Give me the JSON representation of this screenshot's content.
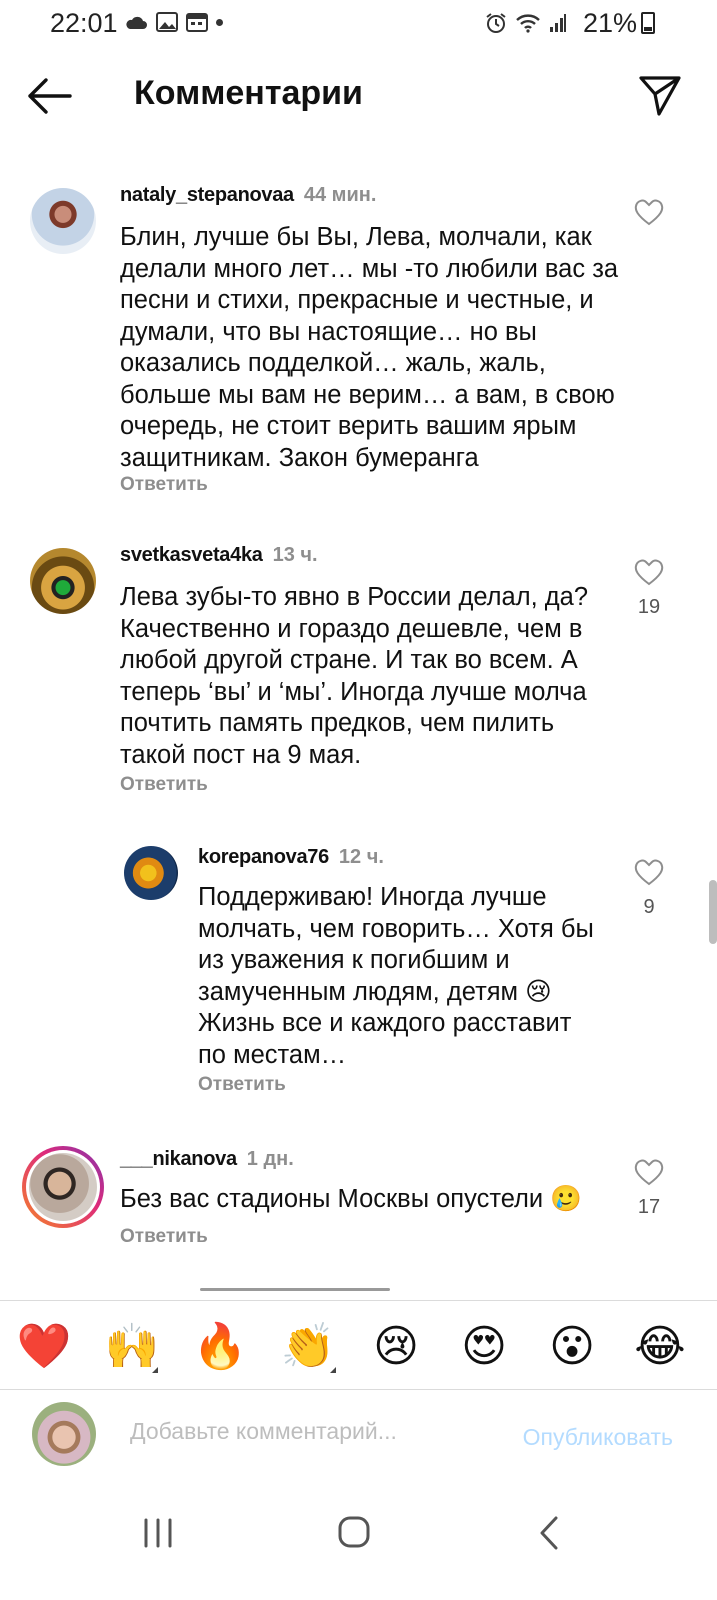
{
  "status_bar": {
    "time": "22:01",
    "battery_text": "21%",
    "left_icons": [
      "cloud-icon",
      "image-icon",
      "calendar-icon",
      "dot-icon"
    ],
    "right_icons": [
      "alarm-icon",
      "wifi-icon",
      "signal-icon",
      "battery-icon"
    ]
  },
  "header": {
    "title": "Комментарии",
    "back_icon": "arrow-left-icon",
    "send_icon": "paper-plane-icon"
  },
  "comments": [
    {
      "username": "nataly_stepanovaa",
      "time": "44 мин.",
      "text": "Блин, лучше бы Вы, Лева, молчали, как делали много лет… мы -то любили вас за песни и стихи, прекрасные и честные, и думали, что вы настоящие… но вы оказались подделкой… жаль, жаль, больше мы вам не верим… а вам, в свою очередь, не стоит верить вашим ярым защитникам. Закон бумеранга",
      "reply": "Ответить",
      "likes": ""
    },
    {
      "username": "svetkasveta4ka",
      "time": "13 ч.",
      "text": "Лева зубы-то явно в России делал, да? Качественно и гораздо дешевле, чем в любой другой стране. И так во всем. А теперь ‘вы’ и ‘мы’. Иногда лучше молча почтить память предков, чем пилить такой пост на 9 мая.",
      "reply": "Ответить",
      "likes": "19"
    },
    {
      "username": "korepanova76",
      "time": "12 ч.",
      "text": "Поддерживаю!  Иногда лучше молчать, чем говорить… Хотя бы из уважения к погибшим и замученным людям, детям 😢 Жизнь все и каждого расставит по местам…",
      "reply": "Ответить",
      "likes": "9"
    },
    {
      "username": "___nikanova",
      "time": "1 дн.",
      "text": "Без вас стадионы Москвы опустели 🥲",
      "reply": "Ответить",
      "likes": "17"
    }
  ],
  "emoji_bar": [
    "❤️",
    "🙌",
    "🔥",
    "👏",
    "😢",
    "😍",
    "😮",
    "😂"
  ],
  "input": {
    "placeholder": "Добавьте комментарий...",
    "post_label": "Опубликовать"
  },
  "nav_bar": {
    "icons": [
      "recent-apps-icon",
      "home-icon",
      "back-icon"
    ]
  },
  "colors": {
    "muted": "#8e8e8e",
    "post_disabled": "#b3dbff",
    "story_ring_start": "#f58529",
    "story_ring_end": "#dd2a7b"
  }
}
